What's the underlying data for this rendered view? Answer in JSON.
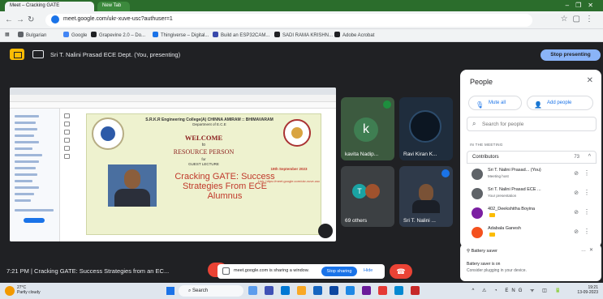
{
  "browser": {
    "tabs": [
      {
        "label": "Meet – Cracking GATE",
        "active": true
      },
      {
        "label": "New Tab",
        "active": false
      }
    ],
    "url": "meet.google.com/ukr-xuve-usc?authuser=1",
    "bookmarks": [
      {
        "label": "Bulgarian",
        "color": "#5f6368"
      },
      {
        "label": "Google",
        "color": "#4285f4"
      },
      {
        "label": "Grapevine 2.0 – Do...",
        "color": "#202124"
      },
      {
        "label": "Thingiverse – Digital...",
        "color": "#1a73e8"
      },
      {
        "label": "Build an ESP32CAM...",
        "color": "#3949ab"
      },
      {
        "label": "SADI RAMA KRISHN...",
        "color": "#202124"
      },
      {
        "label": "Adobe Acrobat",
        "color": "#202124"
      }
    ]
  },
  "meet": {
    "presenting_text": "Sri T. Nalini Prasad ECE Dept. (You, presenting)",
    "stop_presenting": "Stop presenting",
    "bottom_text": "7:21 PM  |  Cracking GATE: Success Strategies from an EC...",
    "share_banner": "meet.google.com is sharing a window.",
    "stop_sharing": "Stop sharing",
    "hide": "Hide",
    "tiles": [
      {
        "name": "kavita Nadip...",
        "initial": "k"
      },
      {
        "name": "Ravi Kiran K..."
      },
      {
        "name": "69 others",
        "initial": "T"
      },
      {
        "name": "Sri T. Nalini ..."
      }
    ]
  },
  "slide": {
    "college": "S.R.K.R Engineering College(A) CHINNA AMIRAM :: BHIMAVARAM",
    "dept": "Department of E.C.E",
    "welcome": "WELCOME",
    "to": "to",
    "resource": "RESOURCE PERSON",
    "for": "for",
    "guest": "GUEST LECTURE",
    "topic": "Cracking GATE: Success Strategies From ECE Alumnus",
    "date": "19th September 2023",
    "link": "Link: https://meet.google.com/ukr-xuve-usc"
  },
  "people": {
    "title": "People",
    "mute_all": "Mute all",
    "add_people": "Add people",
    "search_placeholder": "Search for people",
    "in_meeting": "IN THE MEETING",
    "contributors": "Contributors",
    "count": "73",
    "rows": [
      {
        "name": "Sri T. Nalini Prasad... (You)",
        "sub": "Meeting host",
        "color": "#5f6368"
      },
      {
        "name": "Sri T. Nalini Prasad ECE ...",
        "sub": "Your presentation",
        "color": "#5f6368"
      },
      {
        "name": "402_Deekshitha Boyina",
        "sub": "",
        "color": "#7b1fa2"
      },
      {
        "name": "Adabala Ganesh",
        "sub": "",
        "color": "#f4511e"
      }
    ]
  },
  "battery": {
    "title": "Battery saver",
    "line1": "Battery saver is on",
    "line2": "Consider plugging in your device."
  },
  "taskbar": {
    "weather_temp": "27°C",
    "weather_desc": "Partly cloudy",
    "search": "Search",
    "lang": "ENG",
    "lang2": "IN",
    "time": "19:21",
    "date": "13-09-2023"
  }
}
